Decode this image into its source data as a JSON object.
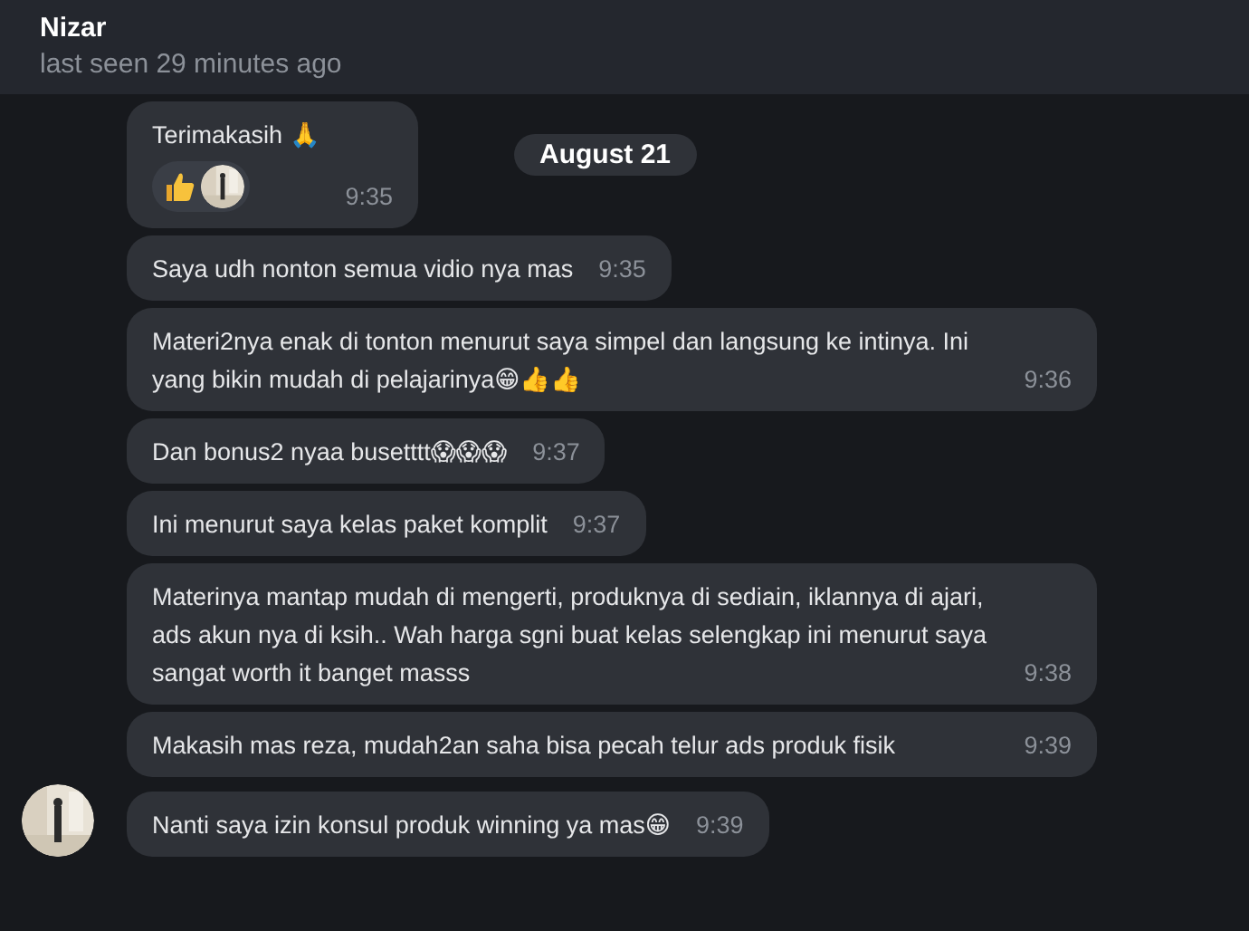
{
  "header": {
    "name": "Nizar",
    "status": "last seen 29 minutes ago"
  },
  "date_divider": "August 21",
  "messages": [
    {
      "text": "Terimakasih 🙏",
      "time": "9:35",
      "reactions": [
        {
          "kind": "thumbs_up"
        },
        {
          "kind": "avatar"
        }
      ],
      "avatar": false
    },
    {
      "text": "Saya udh nonton semua vidio nya mas",
      "time": "9:35",
      "avatar": false
    },
    {
      "text": "Materi2nya enak di tonton menurut saya simpel dan langsung ke intinya. Ini yang bikin mudah di pelajarinya😁👍👍",
      "time": "9:36",
      "avatar": false
    },
    {
      "text": "Dan bonus2 nyaa busetttt😱😱😱",
      "time": "9:37",
      "avatar": false
    },
    {
      "text": "Ini menurut saya kelas paket komplit",
      "time": "9:37",
      "avatar": false
    },
    {
      "text": "Materinya mantap mudah di mengerti, produknya di sediain, iklannya di ajari, ads akun nya di ksih.. Wah harga sgni buat kelas selengkap ini menurut saya sangat worth it banget masss",
      "time": "9:38",
      "avatar": false
    },
    {
      "text": "Makasih mas reza, mudah2an saha bisa pecah telur ads produk fisik",
      "time": "9:39",
      "avatar": false
    },
    {
      "text": "Nanti saya izin konsul produk winning ya mas😁",
      "time": "9:39",
      "avatar": true
    }
  ]
}
